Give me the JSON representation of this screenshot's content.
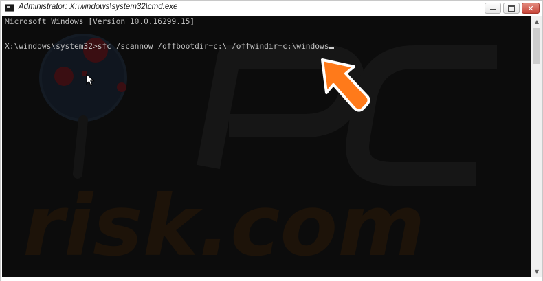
{
  "window": {
    "title": "Administrator: X:\\windows\\system32\\cmd.exe",
    "app_icon": "cmd-icon"
  },
  "controls": {
    "minimize_icon": "minimize-icon",
    "maximize_icon": "maximize-icon",
    "close_glyph": "✕"
  },
  "console": {
    "lines": [
      "Microsoft Windows [Version 10.0.16299.15]",
      "X:\\windows\\system32>sfc /scannow /offbootdir=c:\\ /offwindir=c:\\windows"
    ],
    "background": "#0c0c0c",
    "text_color": "#c0c0c0"
  },
  "watermark": {
    "text": "risk.com"
  },
  "annotation": {
    "arrow_color": "#ff7a1a",
    "arrow_icon": "orange-arrow-icon"
  },
  "scrollbar": {
    "up_glyph": "▲",
    "down_glyph": "▼"
  }
}
